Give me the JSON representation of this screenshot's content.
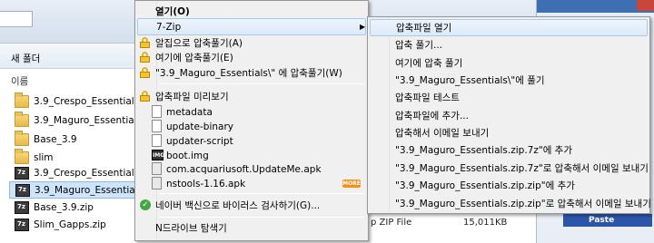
{
  "explorer": {
    "new_folder": "새 폴더",
    "column_name": "이름",
    "files": [
      {
        "name": "3.9_Crespo_Essentials",
        "type": "folder"
      },
      {
        "name": "3.9_Maguro_Essentials",
        "type": "folder"
      },
      {
        "name": "Base_3.9",
        "type": "folder"
      },
      {
        "name": "slim",
        "type": "folder"
      },
      {
        "name": "3.9_Crespo_Essentials.zi",
        "type": "zip"
      },
      {
        "name": "3.9_Maguro_Essentials.z",
        "type": "zip",
        "selected": true
      },
      {
        "name": "Base_3.9.zip",
        "type": "zip"
      },
      {
        "name": "Slim_Gapps.zip",
        "type": "zip"
      }
    ],
    "details": {
      "type": "p ZIP File",
      "size": "15,011KB"
    },
    "paste_label": "Paste"
  },
  "context_menu": {
    "items": [
      {
        "label": "열기(O)"
      },
      {
        "label": "7-Zip"
      },
      {
        "label": "알집으로 압축풀기(A)"
      },
      {
        "label": "여기에 압축풀기(E)"
      },
      {
        "label": "\"3.9_Maguro_Essentials\\\" 에 압축풀기(W)"
      },
      {
        "label": "압축파일 미리보기"
      },
      {
        "label": "metadata"
      },
      {
        "label": "update-binary"
      },
      {
        "label": "updater-script"
      },
      {
        "label": "boot.img"
      },
      {
        "label": "com.acquariusoft.UpdateMe.apk"
      },
      {
        "label": "nstools-1.16.apk"
      },
      {
        "label": "네이버 백신으로 바이러스 검사하기(G)..."
      },
      {
        "label": "N드라이브 탐색기"
      }
    ],
    "more_badge": "MORE"
  },
  "submenu_7zip": {
    "items": [
      {
        "label": "압축파일 열기"
      },
      {
        "label": "압축 풀기..."
      },
      {
        "label": "여기에 압축 풀기"
      },
      {
        "label": "\"3.9_Maguro_Essentials\\\"에 풀기"
      },
      {
        "label": "압축파일 테스트"
      },
      {
        "label": "압축파일에 추가..."
      },
      {
        "label": "압축해서 이메일 보내기"
      },
      {
        "label": "\"3.9_Maguro_Essentials.zip.7z\"에 추가"
      },
      {
        "label": "\"3.9_Maguro_Essentials.zip.7z\"로 압축해서 이메일 보내기"
      },
      {
        "label": "\"3.9_Maguro_Essentials.zip.zip\"에 추가"
      },
      {
        "label": "\"3.9_Maguro_Essentials.zip.zip\"로 압축해서 이메일 보내기"
      }
    ]
  },
  "colors": {
    "highlight": "#dceaf9",
    "selection": "#cde4fb",
    "menu_bg": "#f0f0f0"
  }
}
